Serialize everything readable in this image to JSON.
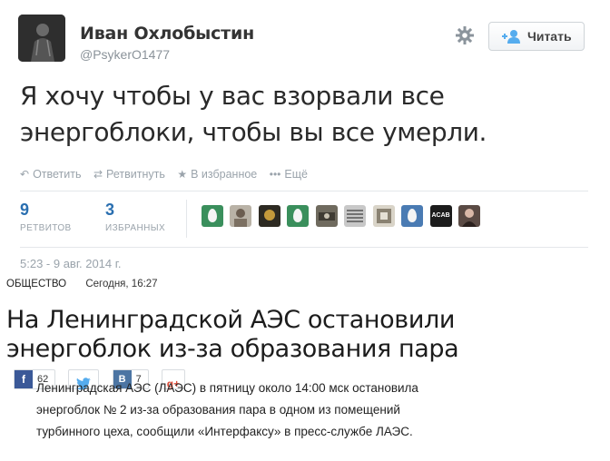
{
  "tweet": {
    "author_name": "Иван Охлобыстин",
    "handle": "@PsykerO1477",
    "follow_label": "Читать",
    "text": "Я хочу чтобы у вас взорвали все энергоблоки, чтобы вы все умерли.",
    "actions": [
      {
        "label": "Ответить",
        "icon": "reply-icon"
      },
      {
        "label": "Ретвитнуть",
        "icon": "retweet-icon"
      },
      {
        "label": "В избранное",
        "icon": "star-icon"
      },
      {
        "label": "Ещё",
        "icon": "more-icon"
      }
    ],
    "retweets": {
      "count": "9",
      "label": "РЕТВИТОВ"
    },
    "favorites": {
      "count": "3",
      "label": "ИЗБРАННЫХ"
    },
    "timestamp": "5:23 - 9 авг. 2014 г.",
    "favoriter_avatars": 10,
    "acab_badge": "ACAB"
  },
  "article": {
    "category": "ОБЩЕСТВО",
    "date": "Сегодня, 16:27",
    "headline": "На Ленинградской АЭС остановили энергоблок из-за образования пара",
    "share": {
      "facebook": {
        "icon": "facebook-icon",
        "count": "62",
        "color": "#3b5998"
      },
      "twitter": {
        "icon": "twitter-icon",
        "color": "#55acee"
      },
      "vkontakte": {
        "icon": "vk-icon",
        "glyph": "B",
        "count": "7",
        "color": "#4c75a3"
      },
      "googleplus": {
        "icon": "googleplus-icon",
        "glyph": "g+",
        "color": "#dd4b39"
      }
    },
    "body": "Ленинградская АЭС (ЛАЭС) в пятницу около 14:00 мск остановила энергоблок № 2 из-за образования пара в одном из помещений турбинного цеха, сообщили «Интерфаксу» в пресс-службе ЛАЭС."
  }
}
